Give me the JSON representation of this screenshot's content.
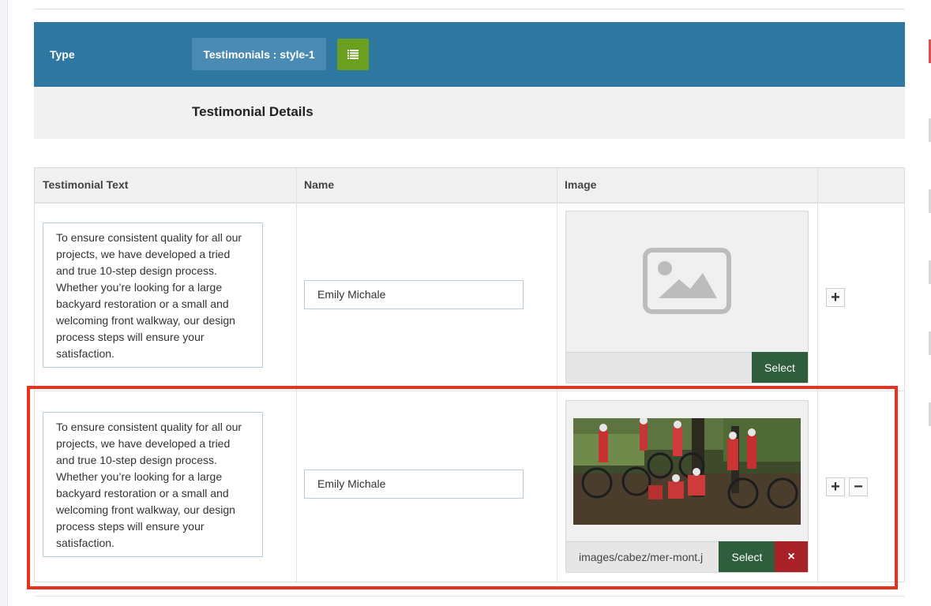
{
  "type_bar": {
    "label": "Type",
    "value": "Testimonials : style-1",
    "accent": "#2e77a1",
    "list_button_icon": "list-icon"
  },
  "details": {
    "title": "Testimonial Details"
  },
  "table": {
    "headers": [
      "Testimonial Text",
      "Name",
      "Image",
      ""
    ],
    "rows": [
      {
        "text": "To ensure consistent quality for all our projects, we have developed a tried and true 10-step design process. Whether you’re looking for a large backyard restoration or a small and welcoming front walkway, our design process steps will ensure your satisfaction.",
        "name": "Emily Michale",
        "image_path": "",
        "image_state": "placeholder",
        "select_label": "Select",
        "actions": [
          "add"
        ]
      },
      {
        "text": "To ensure consistent quality for all our projects, we have developed a tried and true 10-step design process. Whether you’re looking for a large backyard restoration or a small and welcoming front walkway, our design process steps will ensure your satisfaction.",
        "name": "Emily Michale",
        "image_path": "images/cabez/mer-mont.j",
        "image_state": "photo",
        "select_label": "Select",
        "clear_label": "×",
        "actions": [
          "add",
          "remove"
        ]
      }
    ]
  },
  "icons": {
    "add": "+",
    "remove": "−"
  },
  "colors": {
    "select": "#2e5e3c",
    "clear": "#a72127",
    "highlight": "#e8321f",
    "list_button": "#6aa01d"
  }
}
